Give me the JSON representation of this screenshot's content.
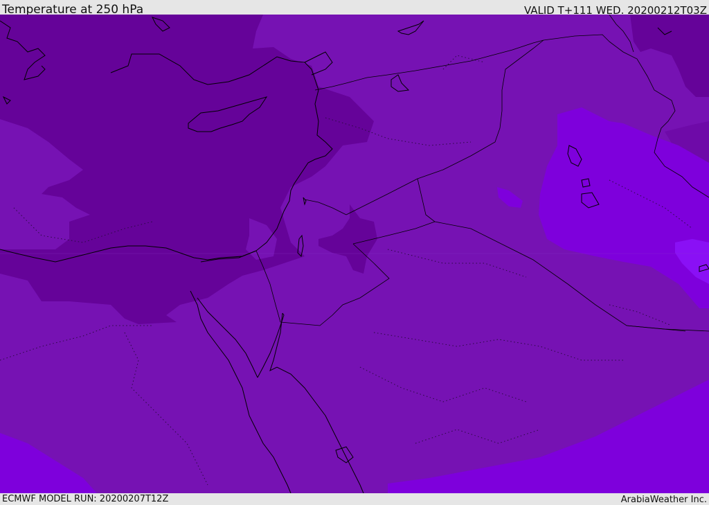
{
  "header": {
    "title": "Temperature at 250 hPa",
    "valid": "VALID T+111 WED. 20200212T03Z"
  },
  "footer": {
    "model_run": "ECMWF MODEL RUN: 20200207T12Z",
    "credit": "ArabiaWeather Inc."
  },
  "map": {
    "field": "temperature",
    "level": "250 hPa",
    "colors": {
      "base": "#7612b3",
      "cold_dark": "#650399",
      "warm_bright": "#7e00dc",
      "warmest": "#8a10f5",
      "coastline": "#000000",
      "border": "#000000"
    }
  }
}
